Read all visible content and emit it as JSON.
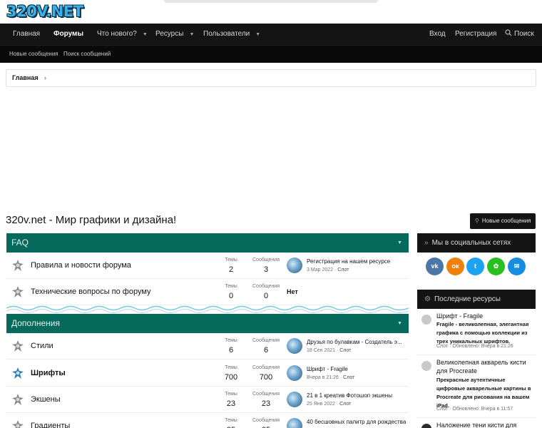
{
  "header": {
    "logo": "320V.NET"
  },
  "nav": {
    "home": "Главная",
    "forums": "Форумы",
    "whats_new": "Что нового?",
    "resources": "Ресурсы",
    "users": "Пользователи",
    "login": "Вход",
    "register": "Регистрация",
    "search": "Поиск"
  },
  "subnav": {
    "new_posts": "Новые сообщения",
    "search_posts": "Поиск сообщений"
  },
  "breadcrumb": {
    "home": "Главная",
    "sep": "›"
  },
  "page": {
    "title": "320v.net - Мир графики и дизайна!",
    "new_posts_button": "Новые сообщения"
  },
  "labels": {
    "topics": "Темы",
    "messages": "Сообщения"
  },
  "categories": [
    {
      "title": "FAQ",
      "nodes": [
        {
          "title": "Правила и новости форума",
          "topics": "2",
          "messages": "3",
          "last_title": "Регистрация на нашем ресурсе",
          "last_date": "3 Мар 2022",
          "last_user": "Слот"
        },
        {
          "title": "Технические вопросы по форуму",
          "topics": "0",
          "messages": "0",
          "last_none": "Нет"
        }
      ]
    },
    {
      "title": "Дополнения",
      "nodes": [
        {
          "title": "Стили",
          "topics": "6",
          "messages": "6",
          "last_title": "Друзья по булавкам - Создатель э...",
          "last_date": "18 Сен 2021",
          "last_user": "Слот"
        },
        {
          "title": "Шрифты",
          "topics": "700",
          "messages": "700",
          "last_title": "Шрифт - Fragile",
          "last_date": "Вчера в 21:26",
          "last_user": "Слот"
        },
        {
          "title": "Экшены",
          "topics": "23",
          "messages": "23",
          "last_title": "21 в 1 креатив Фотошоп экшены",
          "last_date": "25 Янв 2022",
          "last_user": "Слот"
        },
        {
          "title": "Градиенты",
          "topics": "25",
          "messages": "25",
          "last_title": "40 бесшовных палитр для рождества"
        }
      ]
    }
  ],
  "sidebar": {
    "social_title": "Мы в социальных сетях",
    "social": [
      {
        "name": "vk",
        "glyph": "vk",
        "color": "#4a76a8"
      },
      {
        "name": "ok",
        "glyph": "ок",
        "color": "#ee8208"
      },
      {
        "name": "twitter",
        "glyph": "t",
        "color": "#1da1f2"
      },
      {
        "name": "icq",
        "glyph": "✿",
        "color": "#27c01f"
      },
      {
        "name": "mail",
        "glyph": "✉",
        "color": "#168de2"
      }
    ],
    "resources_title": "Последние ресурсы",
    "resources": [
      {
        "title": "Шрифт - Fragile",
        "desc": "Fragile - великолепная, элегантная графика с помощью коллекции из трех уникальных шрифтов.",
        "meta": "Слот · Обновлено: Вчера в 21:26"
      },
      {
        "title": "Великолепная акварель кисти",
        "title2": "для Procreate",
        "desc": "Прекрасные аутентичные цифровые акварельные картины в Procreate для рисования на вашем iPad.",
        "meta": "Слот · Обновлено: Вчера в 11:57"
      },
      {
        "title": "Наложение тени кисти для"
      }
    ]
  }
}
